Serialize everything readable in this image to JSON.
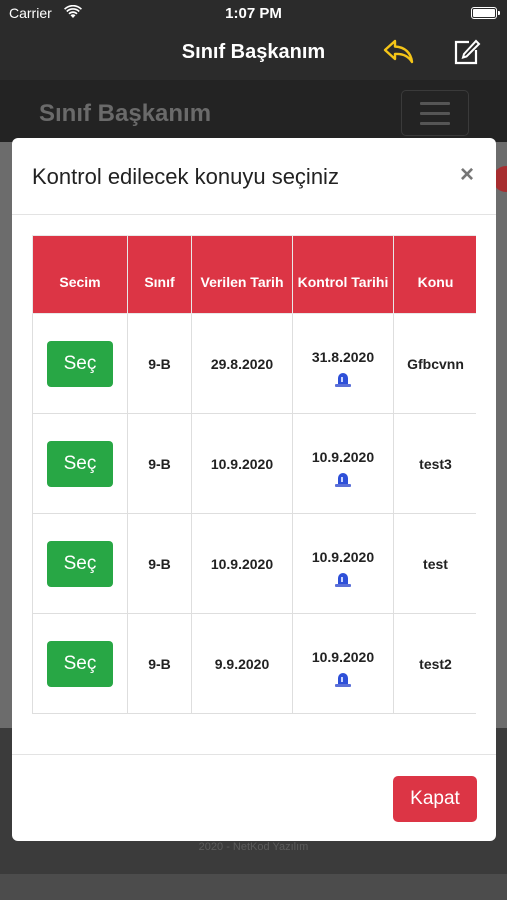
{
  "status_bar": {
    "carrier": "Carrier",
    "time": "1:07 PM"
  },
  "nav_bar": {
    "title": "Sınıf Başkanım",
    "back_icon": "reply-arrow-icon",
    "edit_icon": "compose-icon",
    "accent_color": "#f5c518"
  },
  "page": {
    "brand": "Sınıf Başkanım",
    "footer_text": "2020 - NetKod Yazılım"
  },
  "modal": {
    "title": "Kontrol edilecek konuyu seçiniz",
    "close_label": "×",
    "close_button_label": "Kapat",
    "table": {
      "headers": {
        "secim": "Secim",
        "sinif": "Sınıf",
        "verilen_tarih": "Verilen Tarih",
        "kontrol_tarihi": "Kontrol Tarihi",
        "konu": "Konu"
      },
      "rows": [
        {
          "select_label": "Seç",
          "sinif": "9-B",
          "verilen_tarih": "29.8.2020",
          "kontrol_tarihi": "31.8.2020",
          "konu": "Gfbcvnn"
        },
        {
          "select_label": "Seç",
          "sinif": "9-B",
          "verilen_tarih": "10.9.2020",
          "kontrol_tarihi": "10.9.2020",
          "konu": "test3"
        },
        {
          "select_label": "Seç",
          "sinif": "9-B",
          "verilen_tarih": "10.9.2020",
          "kontrol_tarihi": "10.9.2020",
          "konu": "test"
        },
        {
          "select_label": "Seç",
          "sinif": "9-B",
          "verilen_tarih": "9.9.2020",
          "kontrol_tarihi": "10.9.2020",
          "konu": "test2"
        }
      ]
    }
  },
  "colors": {
    "header_red": "#dc3545",
    "select_green": "#28a745",
    "siren_blue": "#2d4fd8"
  }
}
